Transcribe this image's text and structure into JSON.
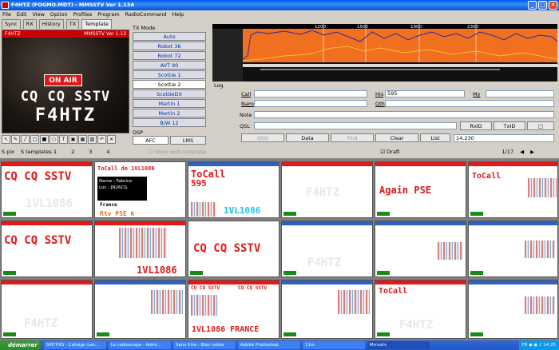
{
  "window": {
    "title": "F4HTZ (FOGMO.MDT) - MMSSTV Ver 1.13A"
  },
  "menu": [
    "File",
    "Edit",
    "View",
    "Option",
    "Profiles",
    "Program",
    "RadioCommand",
    "Help"
  ],
  "tabs": [
    "Sync",
    "RX",
    "History",
    "TX",
    "Template"
  ],
  "rx_image": {
    "header_call": "F4HTZ",
    "header_ver": "MMSSTV Ver 1.13",
    "onair": "ON AIR",
    "cq": "CQ CQ SSTV",
    "call": "F4HTZ"
  },
  "tx_mode": {
    "label": "TX Mode",
    "modes": [
      "Auto",
      "Robot 36",
      "Robot 72",
      "AVT 90",
      "Scottie 1",
      "Scottie 2",
      "ScottieDX",
      "Martin 1",
      "Martin 2",
      "B/W 12"
    ],
    "selected": "Scottie 2"
  },
  "dsp": {
    "label": "DSP",
    "buttons": [
      "AFC",
      "LMS"
    ]
  },
  "show_template": "Show with template",
  "spectrum": {
    "ticks": [
      "1200",
      "1500",
      "1900",
      "2300"
    ]
  },
  "log": {
    "label": "Log",
    "call_label": "Call",
    "his_label": "His",
    "his_value": "595",
    "my_label": "My",
    "name_label": "Name",
    "qth_label": "Qth",
    "note_label": "Note",
    "qsl_label": "QSL",
    "rxid": "RxID",
    "txid": "TxID",
    "buttons": [
      "QSO",
      "Data",
      "Find",
      "Clear",
      "List"
    ],
    "freq": "14.230"
  },
  "strip": {
    "tabs": [
      "S pix",
      "S templates 1",
      "2",
      "3",
      "4"
    ],
    "draft": "Draft",
    "page": "1/17"
  },
  "cells": {
    "c1": "CQ CQ SSTV",
    "c2_title": "ToCall de 1VL1086",
    "c2_name": "Name : Fabrice",
    "c2_loc": "Loc : JN26CG",
    "c2_country": "France",
    "c2_pse": "Rtv PSE k",
    "c3_call": "ToCall",
    "c3_rst": "595",
    "c3_id": "1VL1086",
    "c5": "Again PSE",
    "c6": "ToCall",
    "c7": "CQ CQ SSTV",
    "c8": "1VL1086",
    "c9": "CQ CQ SSTV",
    "c10_wm": "F4HTZ",
    "c15": "CQ CQ SSTV",
    "c15b": "CQ CQ SSTV",
    "c15c": "1VL1086 FRANCE",
    "c17": "ToCall",
    "c17_wm": "F4HTZ"
  },
  "taskbar": {
    "start": "démarrer",
    "tasks": [
      "SM7PXS - Callsign Loo...",
      "Le radioscope - Admi...",
      "Sans titre - Bloc-notes",
      "Adobe Photoshop",
      "11m",
      "Mmsstv"
    ],
    "active": "Mmsstv",
    "lang": "FR",
    "clock": "14:25"
  },
  "colors": {
    "accent_red": "#e01818",
    "spectrum_orange": "#f07020",
    "link_blue": "#003399"
  }
}
